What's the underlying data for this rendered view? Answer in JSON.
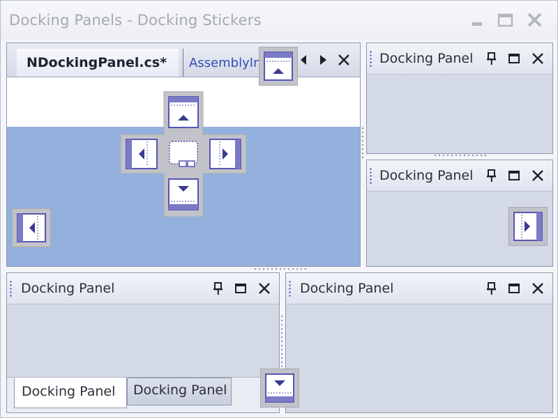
{
  "window": {
    "title": "Docking Panels - Docking Stickers",
    "buttons": {
      "minimize": "minimize-icon",
      "maximize": "maximize-icon",
      "close": "close-icon"
    }
  },
  "document_area": {
    "tabs": [
      {
        "label": "NDockingPanel.cs*",
        "active": true
      },
      {
        "label": "AssemblyInfo.cs",
        "active": false
      }
    ],
    "nav_icons": [
      "scroll-left-icon",
      "scroll-right-icon",
      "close-icon"
    ]
  },
  "panels": {
    "top_right": {
      "title": "Docking Panel"
    },
    "middle_right": {
      "title": "Docking Panel"
    },
    "bottom_left": {
      "title": "Docking Panel"
    },
    "bottom_right": {
      "title": "Docking Panel"
    }
  },
  "bottom_tabs": [
    {
      "label": "Docking Panel",
      "active": true
    },
    {
      "label": "Docking Panel",
      "active": false
    }
  ],
  "colors": {
    "highlight_area": "#94b1de",
    "panel_body": "#d4d9e6",
    "caption_text": "#2b2f3a",
    "accent_blue": "#2f4fb5",
    "sticker_face": "#5656b4"
  }
}
